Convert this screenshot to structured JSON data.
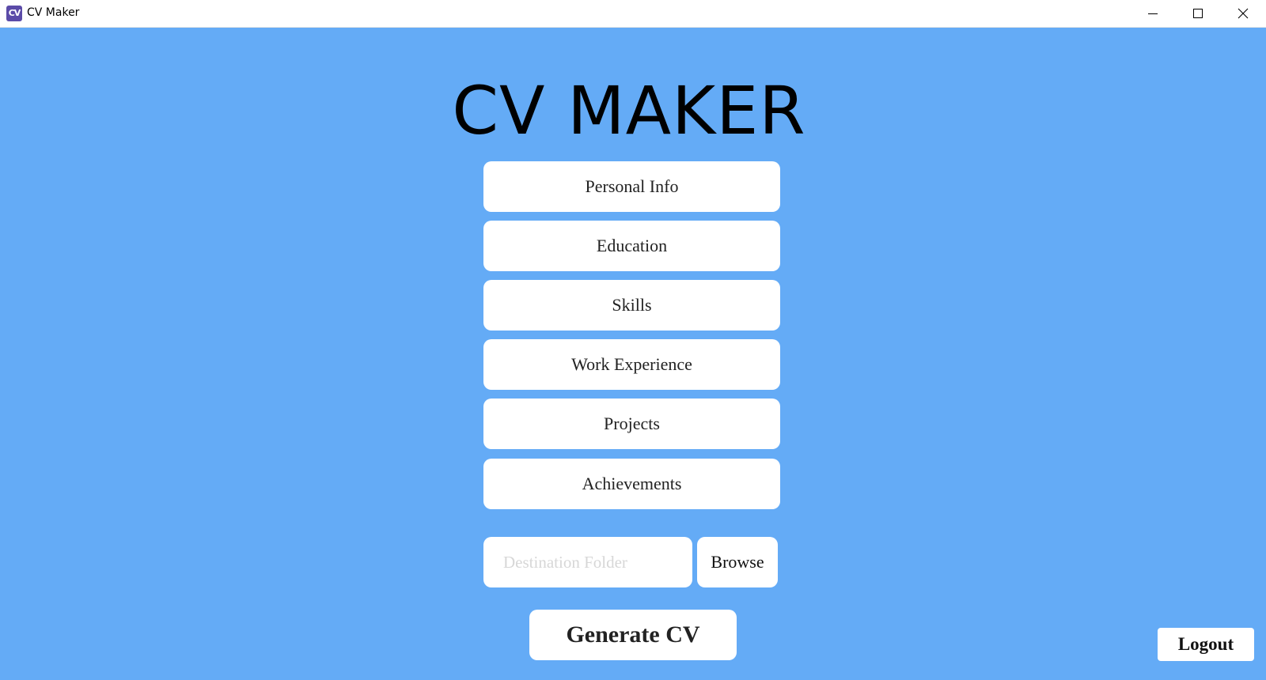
{
  "window": {
    "app_icon_text": "CV",
    "title": "CV Maker"
  },
  "colors": {
    "background": "#64abf6",
    "button_background": "#ffffff"
  },
  "app": {
    "heading": "CV MAKER",
    "sections": {
      "personal_info": "Personal Info",
      "education": "Education",
      "skills": "Skills",
      "work_experience": "Work Experience",
      "projects": "Projects",
      "achievements": "Achievements"
    },
    "destination": {
      "placeholder": "Destination Folder",
      "value": ""
    },
    "browse_label": "Browse",
    "generate_label": "Generate CV",
    "logout_label": "Logout"
  }
}
